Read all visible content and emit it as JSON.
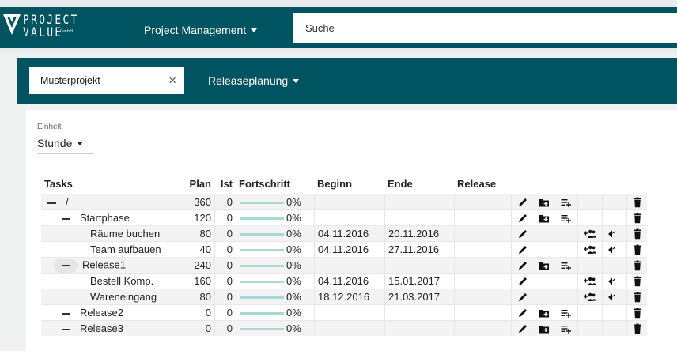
{
  "header": {
    "logo_line1": "PROJECT",
    "logo_line2": "VALUE",
    "logo_suffix": "GmbH",
    "nav_menu": "Project Management",
    "search_placeholder": "Suche"
  },
  "project_bar": {
    "project_name": "Musterprojekt",
    "clear_symbol": "×",
    "view_menu": "Releaseplanung"
  },
  "unit": {
    "label": "Einheit",
    "value": "Stunde"
  },
  "table": {
    "headers": {
      "tasks": "Tasks",
      "plan": "Plan",
      "ist": "Ist",
      "progress": "Fortschritt",
      "begin": "Beginn",
      "end": "Ende",
      "release": "Release"
    },
    "rows": [
      {
        "task": "/",
        "level": 0,
        "plan": "360",
        "ist": "0",
        "progress": "0%",
        "begin": "",
        "end": "",
        "release": ""
      },
      {
        "task": "Startphase",
        "level": 1,
        "plan": "120",
        "ist": "0",
        "progress": "0%",
        "begin": "",
        "end": "",
        "release": ""
      },
      {
        "task": "Räume buchen",
        "level": 2,
        "plan": "80",
        "ist": "0",
        "progress": "0%",
        "begin": "04.11.2016",
        "end": "20.11.2016",
        "release": ""
      },
      {
        "task": "Team aufbauen",
        "level": 2,
        "plan": "40",
        "ist": "0",
        "progress": "0%",
        "begin": "04.11.2016",
        "end": "27.11.2016",
        "release": ""
      },
      {
        "task": "Release1",
        "level": 1,
        "plan": "240",
        "ist": "0",
        "progress": "0%",
        "begin": "",
        "end": "",
        "release": ""
      },
      {
        "task": "Bestell Komp.",
        "level": 2,
        "plan": "160",
        "ist": "0",
        "progress": "0%",
        "begin": "04.11.2016",
        "end": "15.01.2017",
        "release": ""
      },
      {
        "task": "Wareneingang",
        "level": 2,
        "plan": "80",
        "ist": "0",
        "progress": "0%",
        "begin": "18.12.2016",
        "end": "21.03.2017",
        "release": ""
      },
      {
        "task": "Release2",
        "level": 1,
        "plan": "0",
        "ist": "0",
        "progress": "0%",
        "begin": "",
        "end": "",
        "release": ""
      },
      {
        "task": "Release3",
        "level": 1,
        "plan": "0",
        "ist": "0",
        "progress": "0%",
        "begin": "",
        "end": "",
        "release": ""
      }
    ]
  },
  "colors": {
    "header_bg": "#005461",
    "progress_bar": "#a9d7d6"
  }
}
